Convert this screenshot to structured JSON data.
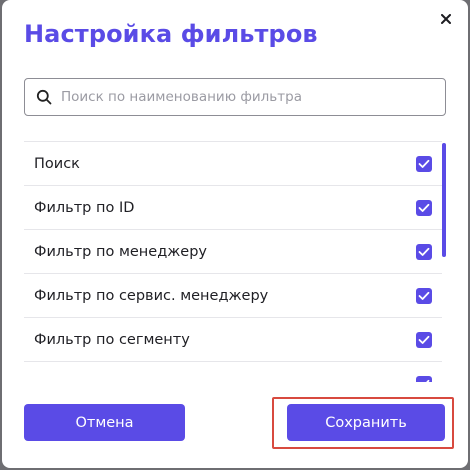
{
  "dialog": {
    "title": "Настройка фильтров",
    "close_icon": "close-icon"
  },
  "search": {
    "placeholder": "Поиск по наименованию фильтра",
    "value": "",
    "icon": "search-icon"
  },
  "filters": [
    {
      "label": "Поиск",
      "checked": true
    },
    {
      "label": "Фильтр по ID",
      "checked": true
    },
    {
      "label": "Фильтр по менеджеру",
      "checked": true
    },
    {
      "label": "Фильтр по сервис. менеджеру",
      "checked": true
    },
    {
      "label": "Фильтр по сегменту",
      "checked": true
    },
    {
      "label": "",
      "checked": true
    }
  ],
  "footer": {
    "cancel_label": "Отмена",
    "save_label": "Сохранить"
  },
  "colors": {
    "accent": "#5a4be6",
    "highlight": "#d84a3f",
    "overlay": "#6e6e72"
  }
}
